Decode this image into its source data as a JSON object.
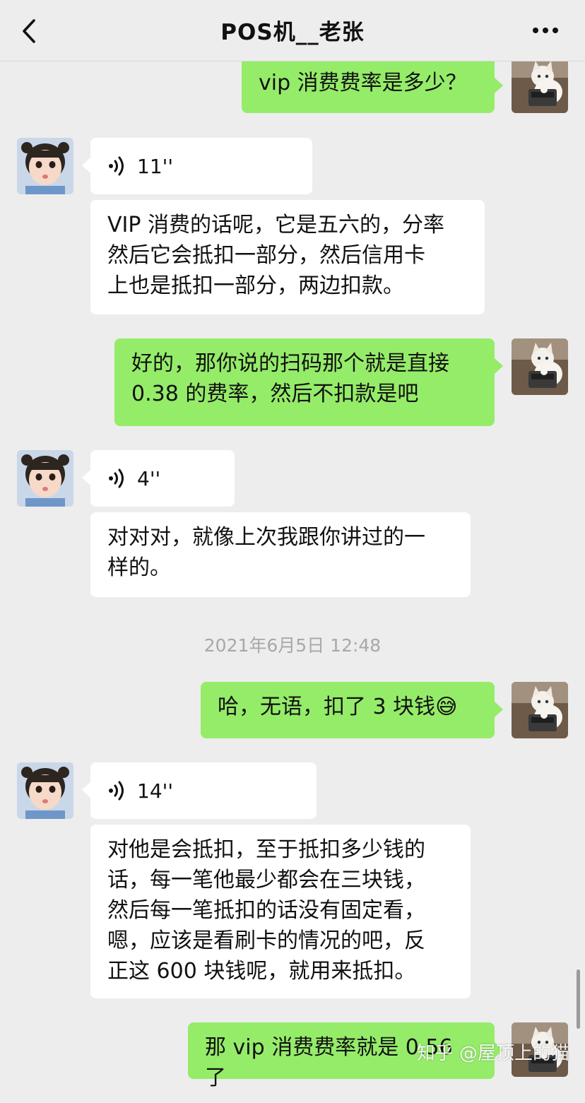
{
  "header": {
    "title": "POS机__老张",
    "back_icon": "chevron-left-icon",
    "more_icon": "more-dots-icon"
  },
  "messages": [
    {
      "sender": "me",
      "type": "text",
      "text": "vip 消费费率是多少？"
    },
    {
      "sender": "other",
      "type": "voice",
      "duration": "11''"
    },
    {
      "sender": "other",
      "type": "text",
      "text": "VIP 消费的话呢，它是五六的，分率\n然后它会抵扣一部分，然后信用卡\n上也是抵扣一部分，两边扣款。"
    },
    {
      "sender": "me",
      "type": "text",
      "text": "好的，那你说的扫码那个就是直接\n0.38 的费率，然后不扣款是吧"
    },
    {
      "sender": "other",
      "type": "voice",
      "duration": "4''"
    },
    {
      "sender": "other",
      "type": "text",
      "text": "对对对，就像上次我跟你讲过的一\n样的。"
    },
    {
      "sender": "me",
      "type": "text",
      "text": "哈，无语，扣了 3 块钱😅"
    },
    {
      "sender": "other",
      "type": "voice",
      "duration": "14''"
    },
    {
      "sender": "other",
      "type": "text",
      "text": "对他是会抵扣，至于抵扣多少钱的\n话，每一笔他最少都会在三块钱，\n然后每一笔抵扣的话没有固定看，\n嗯，应该是看刷卡的情况的吧，反\n正这 600 块钱呢，就用来抵扣。"
    },
    {
      "sender": "me",
      "type": "text",
      "text": "那 vip 消费费率就是 0.56 了"
    }
  ],
  "timestamp": "2021年6月5日 12:48",
  "watermark": "知乎 @屋顶上的猫",
  "colors": {
    "background": "#ededed",
    "bubble_out": "#95ec69",
    "bubble_in": "#ffffff",
    "timestamp": "#a8a8a8"
  }
}
